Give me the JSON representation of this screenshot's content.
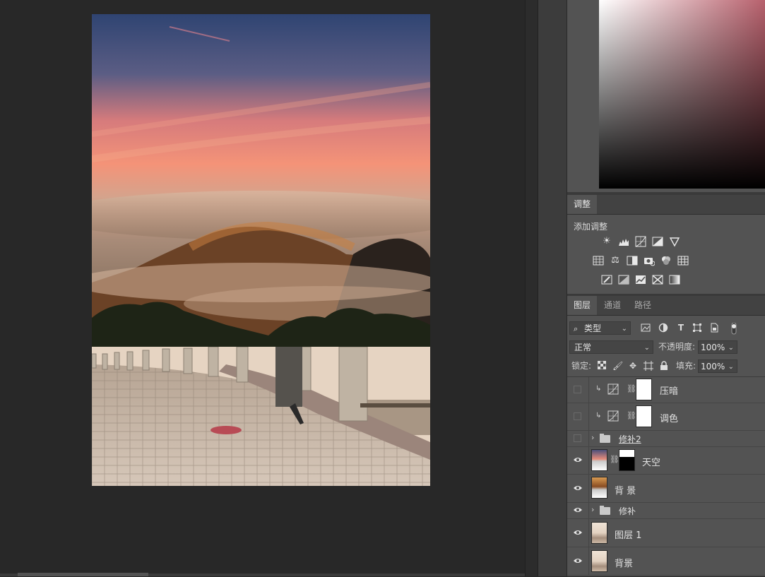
{
  "adjustments_panel": {
    "tab": "调整",
    "title": "添加调整",
    "icons": [
      "brightness-contrast-icon",
      "levels-icon",
      "curves-icon",
      "exposure-icon",
      "vibrance-icon",
      "hue-saturation-icon",
      "color-balance-icon",
      "black-white-icon",
      "photo-filter-icon",
      "channel-mixer-icon",
      "color-lookup-icon",
      "invert-icon",
      "posterize-icon",
      "threshold-icon",
      "selective-color-icon",
      "gradient-map-icon"
    ]
  },
  "layers_panel": {
    "tabs": [
      "图层",
      "通道",
      "路径"
    ],
    "filter_kind": "类型",
    "blend_mode": "正常",
    "opacity_label": "不透明度:",
    "opacity_value": "100%",
    "lock_label": "锁定:",
    "fill_label": "填充:",
    "fill_value": "100%",
    "layers": [
      {
        "name": "压暗",
        "visible": false,
        "kind": "curves-adjustment",
        "clipped": true
      },
      {
        "name": "调色",
        "visible": false,
        "kind": "curves-adjustment",
        "clipped": true
      },
      {
        "name": "修补2",
        "visible": false,
        "kind": "group"
      },
      {
        "name": "天空",
        "visible": true,
        "kind": "masked-pixel"
      },
      {
        "name": "背 景",
        "visible": true,
        "kind": "pixel"
      },
      {
        "name": "修补",
        "visible": true,
        "kind": "group"
      },
      {
        "name": "图层 1",
        "visible": true,
        "kind": "pixel"
      },
      {
        "name": "背景",
        "visible": true,
        "kind": "pixel"
      }
    ]
  }
}
